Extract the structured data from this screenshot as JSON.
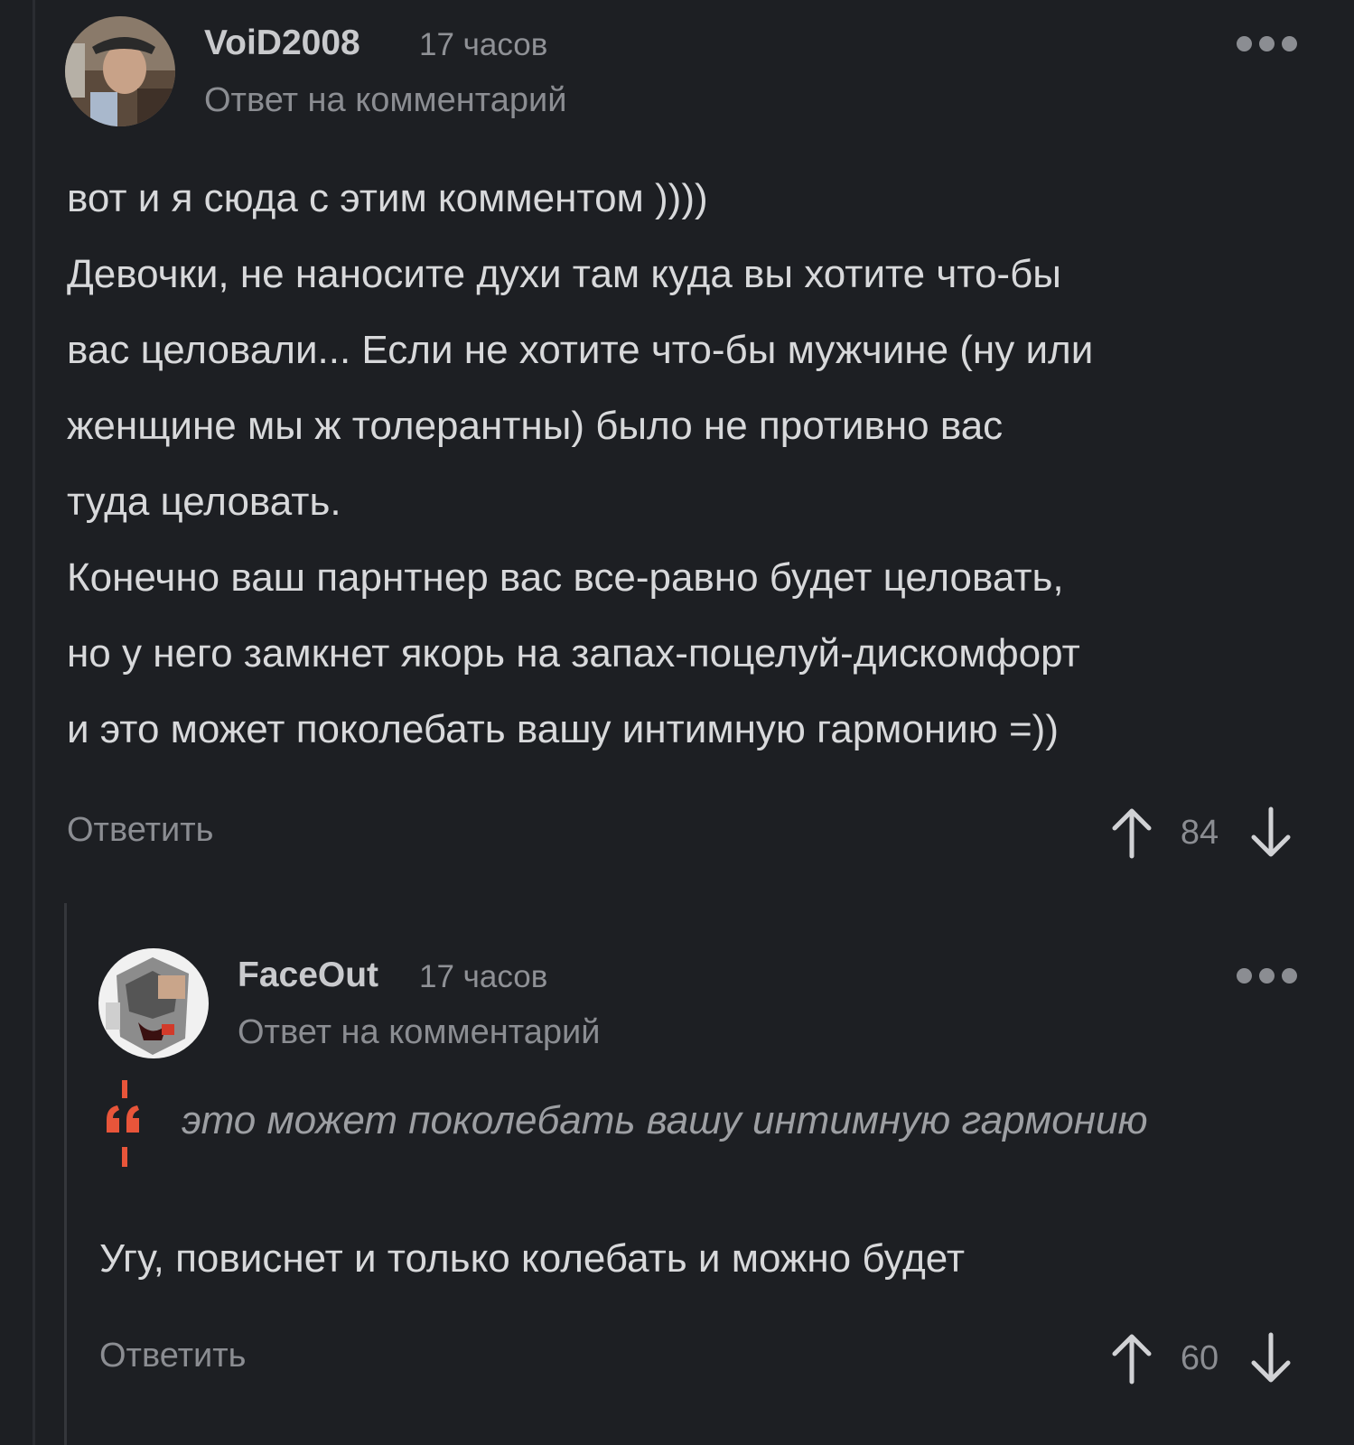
{
  "comments": [
    {
      "author": "VoiD2008",
      "time": "17 часов",
      "reply_label": "Ответ на комментарий",
      "body": [
        "вот и я сюда с этим комментом ))))",
        "Девочки, не наносите духи там куда вы хотите что-бы",
        "вас целовали... Если не хотите что-бы мужчине (ну или",
        "женщине мы ж толерантны)  было не противно вас",
        "туда целовать.",
        "Конечно ваш парнтнер вас все-равно будет целовать,",
        "но у него замкнет якорь на запах-поцелуй-дискомфорт",
        "и это может поколебать вашу интимную гармонию =))"
      ],
      "reply_button": "Ответить",
      "rating": "84"
    },
    {
      "author": "FaceOut",
      "time": "17 часов",
      "reply_label": "Ответ на комментарий",
      "quote": "это может поколебать вашу интимную гармонию",
      "body": [
        "Угу, повиснет и только колебать и можно будет"
      ],
      "reply_button": "Ответить",
      "rating": "60"
    }
  ],
  "colors": {
    "background": "#1d1f23",
    "text": "#d8d9db",
    "muted": "#8b8d92",
    "quote_accent": "#e8553a"
  },
  "icons": [
    "more-dots-icon",
    "arrow-up-icon",
    "arrow-down-icon",
    "quote-icon"
  ]
}
